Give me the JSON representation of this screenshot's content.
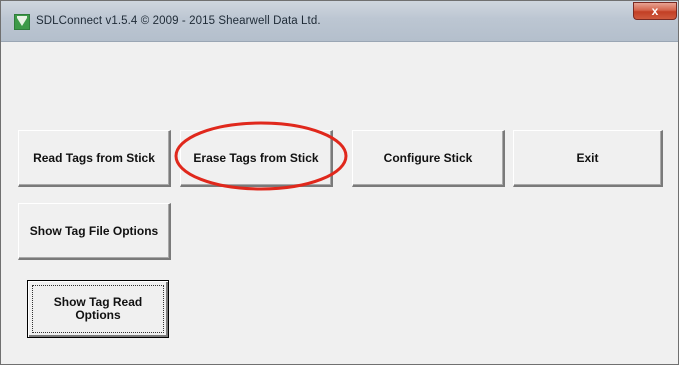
{
  "window": {
    "title": "SDLConnect v1.5.4 © 2009 - 2015 Shearwell Data Ltd.",
    "icon": "sdl-app-icon",
    "close_icon": "close-icon",
    "close_label": "x"
  },
  "buttons": {
    "read_tags": "Read Tags from Stick",
    "erase_tags": "Erase Tags from Stick",
    "configure_stick": "Configure Stick",
    "exit": "Exit",
    "show_tag_file_options": "Show Tag File Options",
    "show_tag_read_options": "Show Tag Read\nOptions"
  },
  "colors": {
    "annotation_circle": "#e0281c",
    "window_background": "#f0f0f0",
    "close_button": "#c9462c"
  }
}
